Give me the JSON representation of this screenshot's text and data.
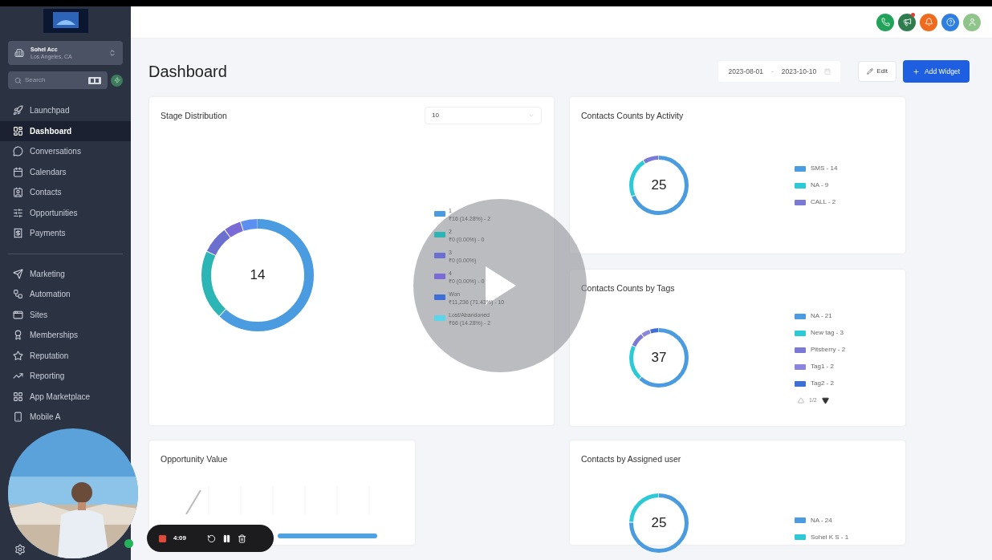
{
  "account": {
    "name": "Sohel Acc",
    "location": "Los Angeles, CA"
  },
  "search": {
    "placeholder": "Search"
  },
  "nav_primary": [
    {
      "label": "Launchpad",
      "selected": false
    },
    {
      "label": "Dashboard",
      "selected": true
    },
    {
      "label": "Conversations",
      "selected": false
    },
    {
      "label": "Calendars",
      "selected": false
    },
    {
      "label": "Contacts",
      "selected": false
    },
    {
      "label": "Opportunities",
      "selected": false
    },
    {
      "label": "Payments",
      "selected": false
    }
  ],
  "nav_secondary": [
    {
      "label": "Marketing",
      "selected": false
    },
    {
      "label": "Automation",
      "selected": false
    },
    {
      "label": "Sites",
      "selected": false
    },
    {
      "label": "Memberships",
      "selected": false
    },
    {
      "label": "Reputation",
      "selected": false
    },
    {
      "label": "Reporting",
      "selected": false
    },
    {
      "label": "App Marketplace",
      "selected": false
    },
    {
      "label": "Mobile A",
      "selected": false
    }
  ],
  "header_icons": [
    {
      "kind": "phone",
      "color": "#22a35a",
      "badge": false
    },
    {
      "kind": "megaphone",
      "color": "#2f7d4e",
      "badge": true
    },
    {
      "kind": "bell",
      "color": "#f06a1d",
      "badge": false
    },
    {
      "kind": "help",
      "color": "#2f7fe0",
      "badge": false
    },
    {
      "kind": "avatar",
      "color": "#8fc58a",
      "badge": false
    }
  ],
  "page": {
    "title": "Dashboard",
    "date_start": "2023-08-01",
    "date_separator": "-",
    "date_end": "2023-10-10",
    "edit_button": "Edit",
    "add_button": "Add Widget"
  },
  "stage_distribution": {
    "title": "Stage Distribution",
    "dropdown": "10",
    "total": "14",
    "legend": [
      {
        "name": "1",
        "detail": "₹16 (14.28%) - 2",
        "color": "#4a9be0"
      },
      {
        "name": "2",
        "detail": "₹0 (0.00%) - 0",
        "color": "#2cb5b5"
      },
      {
        "name": "3",
        "detail": "₹0 (0.00%)",
        "color": "#6a6fd0"
      },
      {
        "name": "4",
        "detail": "₹0 (0.00%) - 0",
        "color": "#7a6ad6"
      },
      {
        "name": "Won",
        "detail": "₹11,236 (71.43%) - 10",
        "color": "#3d6fd6"
      },
      {
        "name": "Lost/Abandoned",
        "detail": "₹66 (14.28%) - 2",
        "color": "#5ad6ec"
      }
    ]
  },
  "activity": {
    "title": "Contacts Counts by Activity",
    "total": "25",
    "legend": [
      {
        "label": "SMS - 14",
        "color": "#4a9be0"
      },
      {
        "label": "NA - 9",
        "color": "#2cc9d6"
      },
      {
        "label": "CALL - 2",
        "color": "#7a7ad6"
      }
    ]
  },
  "tags": {
    "title": "Contacts Counts by Tags",
    "total": "37",
    "page": "1/2",
    "legend": [
      {
        "label": "NA - 21",
        "color": "#4a9be0"
      },
      {
        "label": "New tag - 3",
        "color": "#2cc9d6"
      },
      {
        "label": "Pitsberry - 2",
        "color": "#7a7ad6"
      },
      {
        "label": "Tag1 - 2",
        "color": "#8a86e0"
      },
      {
        "label": "Tag2 - 2",
        "color": "#3d6fd6"
      }
    ]
  },
  "opportunity": {
    "title": "Opportunity Value"
  },
  "assigned": {
    "title": "Contacts by Assigned user",
    "total": "25",
    "legend": [
      {
        "label": "NA - 24",
        "color": "#4a9be0"
      },
      {
        "label": "Sohel K S - 1",
        "color": "#2cc9d6"
      }
    ]
  },
  "recorder": {
    "time": "4:09"
  }
}
